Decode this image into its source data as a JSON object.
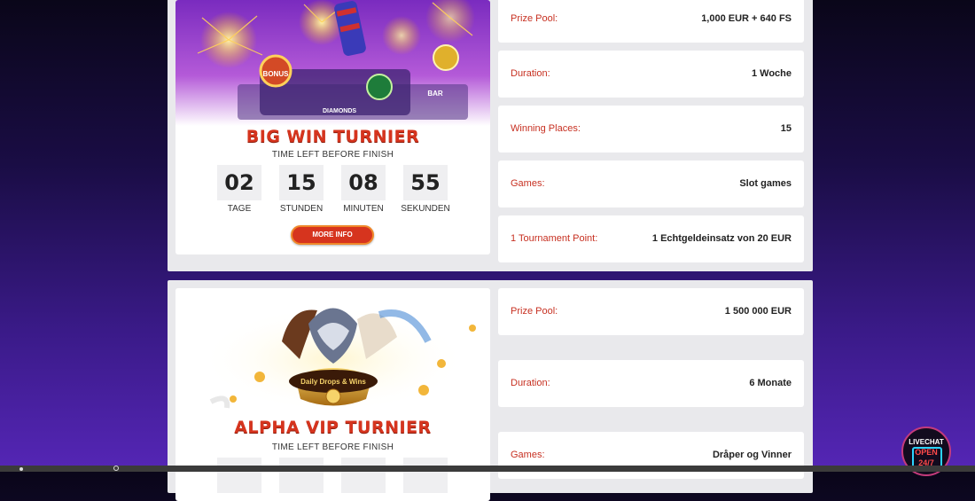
{
  "tournaments": [
    {
      "title": "BIG WIN TURNIER",
      "subtitle": "TIME LEFT BEFORE FINISH",
      "countdown": [
        {
          "value": "02",
          "label": "TAGE"
        },
        {
          "value": "15",
          "label": "STUNDEN"
        },
        {
          "value": "08",
          "label": "MINUTEN"
        },
        {
          "value": "55",
          "label": "SEKUNDEN"
        }
      ],
      "more_info_label": "MORE INFO",
      "details": [
        {
          "key": "Prize Pool:",
          "value": "1,000 EUR + 640 FS"
        },
        {
          "key": "Duration:",
          "value": "1 Woche"
        },
        {
          "key": "Winning Places:",
          "value": "15"
        },
        {
          "key": "Games:",
          "value": "Slot games"
        },
        {
          "key": "1 Tournament Point:",
          "value": "1 Echtgeldeinsatz von 20 EUR"
        }
      ],
      "banner_logo_texts": [
        "BONUS",
        "DIAMONDS",
        "BAR"
      ]
    },
    {
      "title": "ALPHA VIP TURNIER",
      "subtitle": "TIME LEFT BEFORE FINISH",
      "details": [
        {
          "key": "Prize Pool:",
          "value": "1 500 000 EUR"
        },
        {
          "key": "Duration:",
          "value": "6 Monate"
        },
        {
          "key": "Games:",
          "value": "Dråper og Vinner"
        }
      ],
      "banner_logo_text": "Daily Drops & Wins"
    }
  ],
  "livechat": {
    "label": "LIVECHAT",
    "open": "OPEN",
    "hours": "24/7"
  },
  "colors": {
    "accent": "#d6341e",
    "key_text": "#c73021"
  }
}
